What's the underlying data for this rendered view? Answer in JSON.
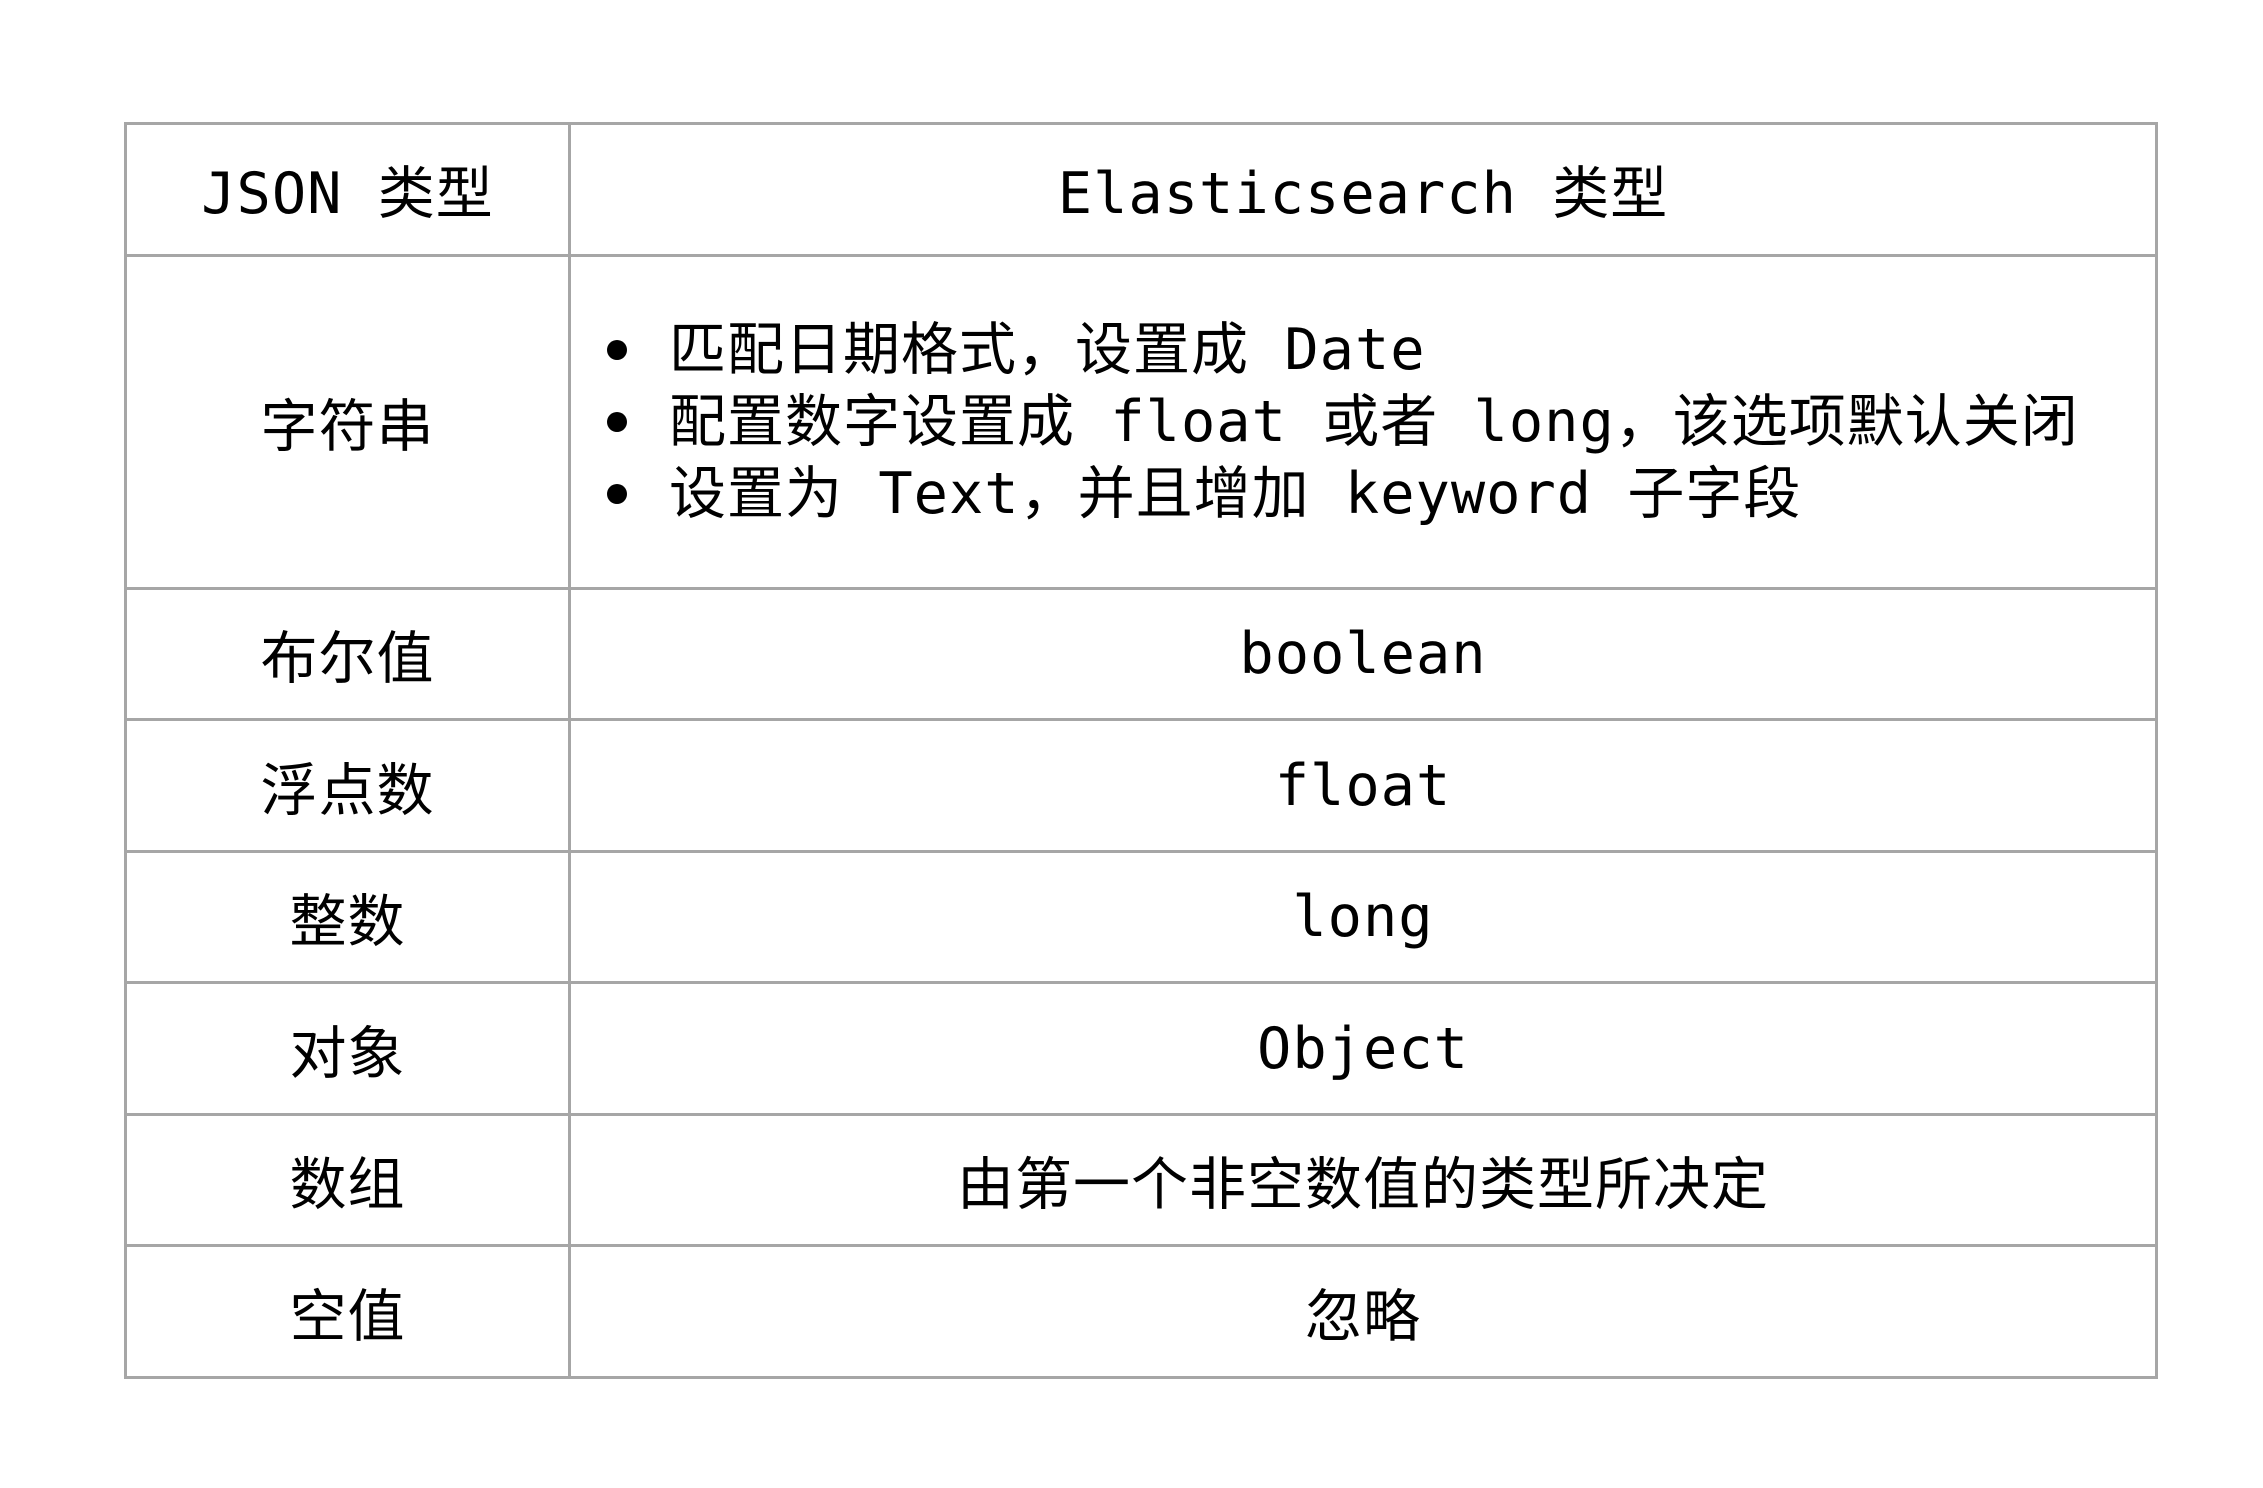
{
  "table": {
    "header": {
      "json_type": "JSON 类型",
      "es_type": "Elasticsearch 类型"
    },
    "string_row": {
      "json_type": "字符串",
      "es_items": [
        "匹配日期格式，设置成 Date",
        "配置数字设置成 float 或者 long，该选项默认关闭",
        "设置为 Text，并且增加 keyword 子字段"
      ]
    },
    "rows": [
      {
        "json_type": "布尔值",
        "es_type": "boolean"
      },
      {
        "json_type": "浮点数",
        "es_type": "float"
      },
      {
        "json_type": "整数",
        "es_type": "long"
      },
      {
        "json_type": "对象",
        "es_type": "Object"
      },
      {
        "json_type": "数组",
        "es_type": "由第一个非空数值的类型所决定"
      },
      {
        "json_type": "空值",
        "es_type": "忽略"
      }
    ]
  },
  "colors": {
    "border": "#a6a6a6",
    "text": "#000000",
    "background": "#ffffff"
  },
  "icons": {
    "bullet": "bullet-dot-icon"
  }
}
